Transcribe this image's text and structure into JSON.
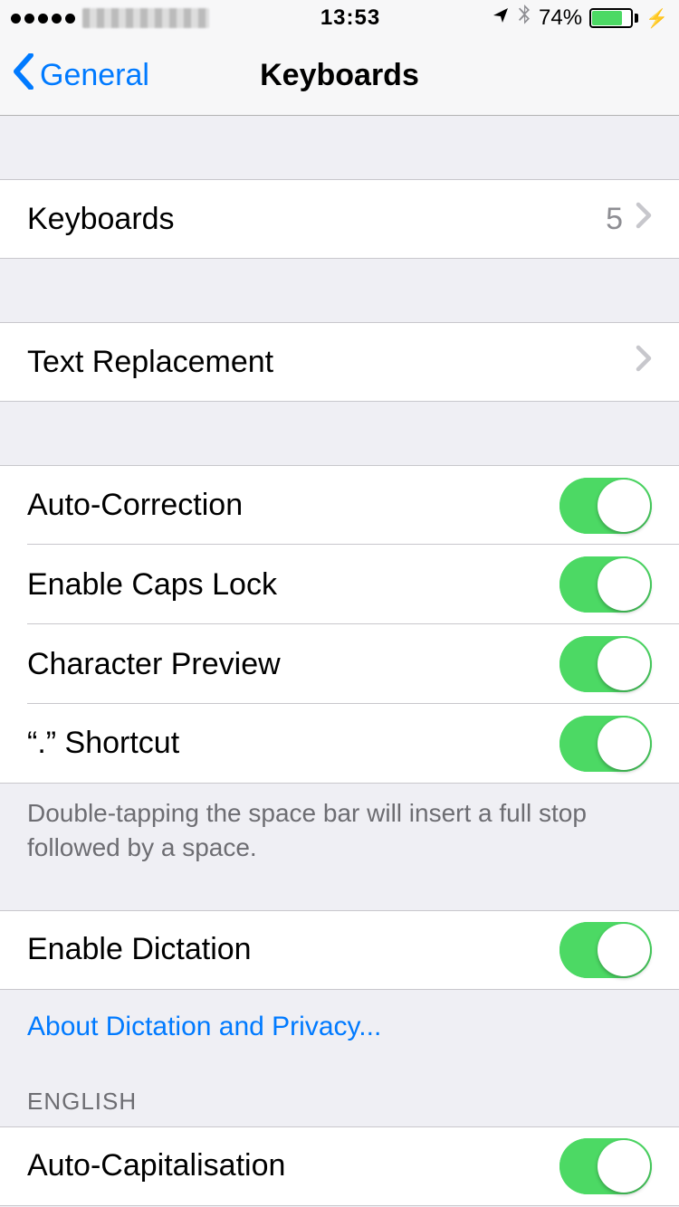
{
  "status": {
    "time": "13:53",
    "battery_percent": "74%",
    "location_icon": "location-arrow",
    "bluetooth_icon": "bluetooth"
  },
  "nav": {
    "back_label": "General",
    "title": "Keyboards"
  },
  "rows": {
    "keyboards": {
      "label": "Keyboards",
      "value": "5"
    },
    "text_replacement": {
      "label": "Text Replacement"
    },
    "auto_correction": {
      "label": "Auto-Correction",
      "on": true
    },
    "caps_lock": {
      "label": "Enable Caps Lock",
      "on": true
    },
    "char_preview": {
      "label": "Character Preview",
      "on": true
    },
    "dot_shortcut": {
      "label": "“.” Shortcut",
      "on": true
    },
    "dictation": {
      "label": "Enable Dictation",
      "on": true
    },
    "auto_cap": {
      "label": "Auto-Capitalisation",
      "on": true
    }
  },
  "footers": {
    "shortcut_desc": "Double-tapping the space bar will insert a full stop followed by a space.",
    "dictation_link": "About Dictation and Privacy..."
  },
  "sections": {
    "english": "ENGLISH"
  }
}
